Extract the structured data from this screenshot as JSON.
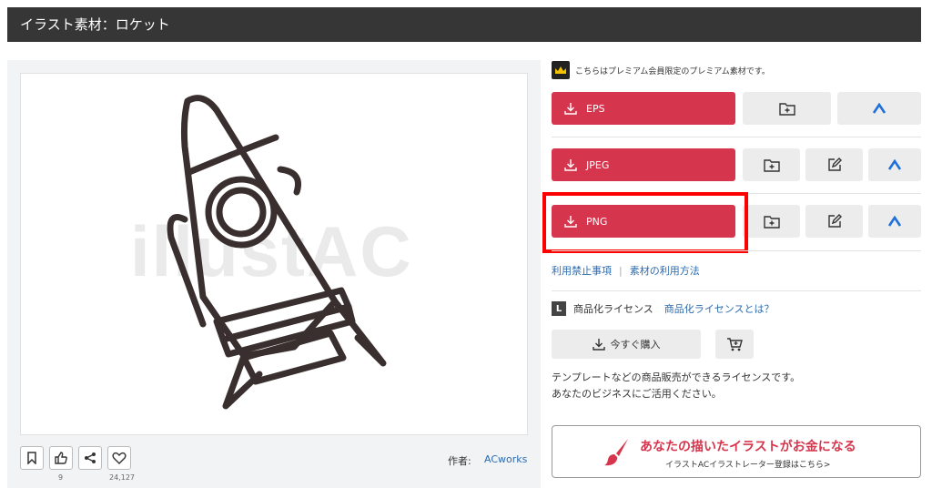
{
  "header": {
    "title": "イラスト素材：ロケット"
  },
  "preview": {
    "watermark": "illustAC",
    "likes_count": "9",
    "favorites_count": "24,127",
    "author_label": "作者:",
    "author_name": "ACworks"
  },
  "premium": {
    "notice": "こちらはプレミアム会員限定のプレミアム素材です。"
  },
  "downloads": [
    {
      "label": "EPS"
    },
    {
      "label": "JPEG"
    },
    {
      "label": "PNG"
    }
  ],
  "links": {
    "prohibited": "利用禁止事項",
    "usage": "素材の利用方法"
  },
  "license": {
    "badge": "L",
    "title": "商品化ライセンス",
    "what_link": "商品化ライセンスとは？",
    "buy_label": "今すぐ購入",
    "desc_line1": "テンプレートなどの商品販売ができるライセンスです。",
    "desc_line2": "あなたのビジネスにご活用ください。"
  },
  "promo": {
    "title": "あなたの描いたイラストがお金になる",
    "subtitle": "イラストACイラストレーター登録はこちら>"
  },
  "colors": {
    "accent": "#d6364d",
    "header_bg": "#363636",
    "link": "#2b6cb0",
    "highlight": "#ff0000"
  }
}
